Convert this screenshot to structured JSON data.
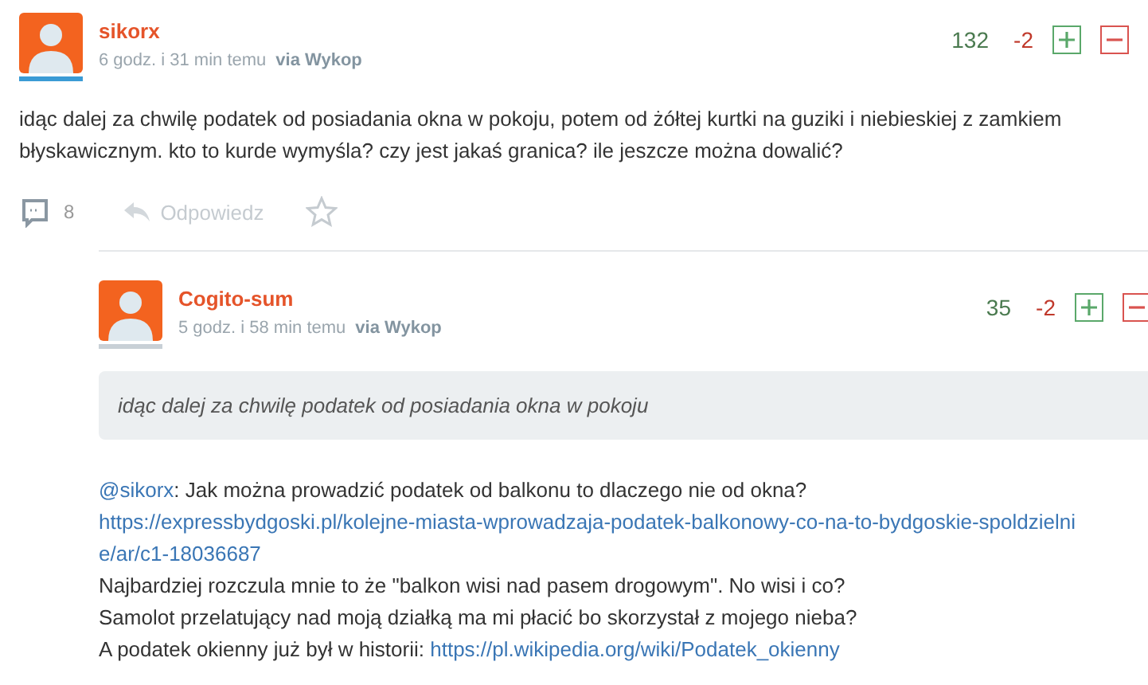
{
  "entry": {
    "author": "sikorx",
    "color": "#3a9bd5",
    "time": "6 godz. i 31 min temu",
    "via": "via Wykop",
    "plus_count": "132",
    "minus_count": "-2",
    "body": "idąc dalej za chwilę podatek od posiadania okna w pokoju, potem od żółtej kurtki na guziki i niebieskiej z zamkiem błyskawicznym. kto to kurde wymyśla? czy jest jakaś granica? ile jeszcze można dowalić?",
    "comments_count": "8",
    "reply_label": "Odpowiedz",
    "favorited": false
  },
  "comment": {
    "author": "Cogito-sum",
    "color": "#c8d0d6",
    "time": "5 godz. i 58 min temu",
    "via": "via Wykop",
    "plus_count": "35",
    "minus_count": "-2",
    "quote": "idąc dalej za chwilę podatek od posiadania okna w pokoju",
    "lines": [
      {
        "parts": [
          {
            "kind": "link",
            "text": "@sikorx"
          },
          {
            "kind": "text",
            "text": ": Jak można prowadzić podatek od balkonu to dlaczego nie od okna?"
          }
        ]
      },
      {
        "parts": [
          {
            "kind": "url",
            "text": "https://expressbydgoski.pl/kolejne-miasta-wprowadzaja-podatek-balkonowy-co-na-to-bydgoskie-spoldzielnie/ar/c1-18036687"
          }
        ]
      },
      {
        "parts": [
          {
            "kind": "text",
            "text": "Najbardziej rozczula mnie to że \"balkon wisi nad pasem drogowym\". No wisi i co?"
          }
        ]
      },
      {
        "parts": [
          {
            "kind": "text",
            "text": "Samolot przelatujący nad moją działką ma mi płacić bo skorzystał z mojego nieba?"
          }
        ]
      },
      {
        "parts": [
          {
            "kind": "text",
            "text": "A podatek okienny już był w historii: "
          },
          {
            "kind": "link",
            "text": "https://pl.wikipedia.org/wiki/Podatek_okienny"
          }
        ]
      }
    ]
  }
}
